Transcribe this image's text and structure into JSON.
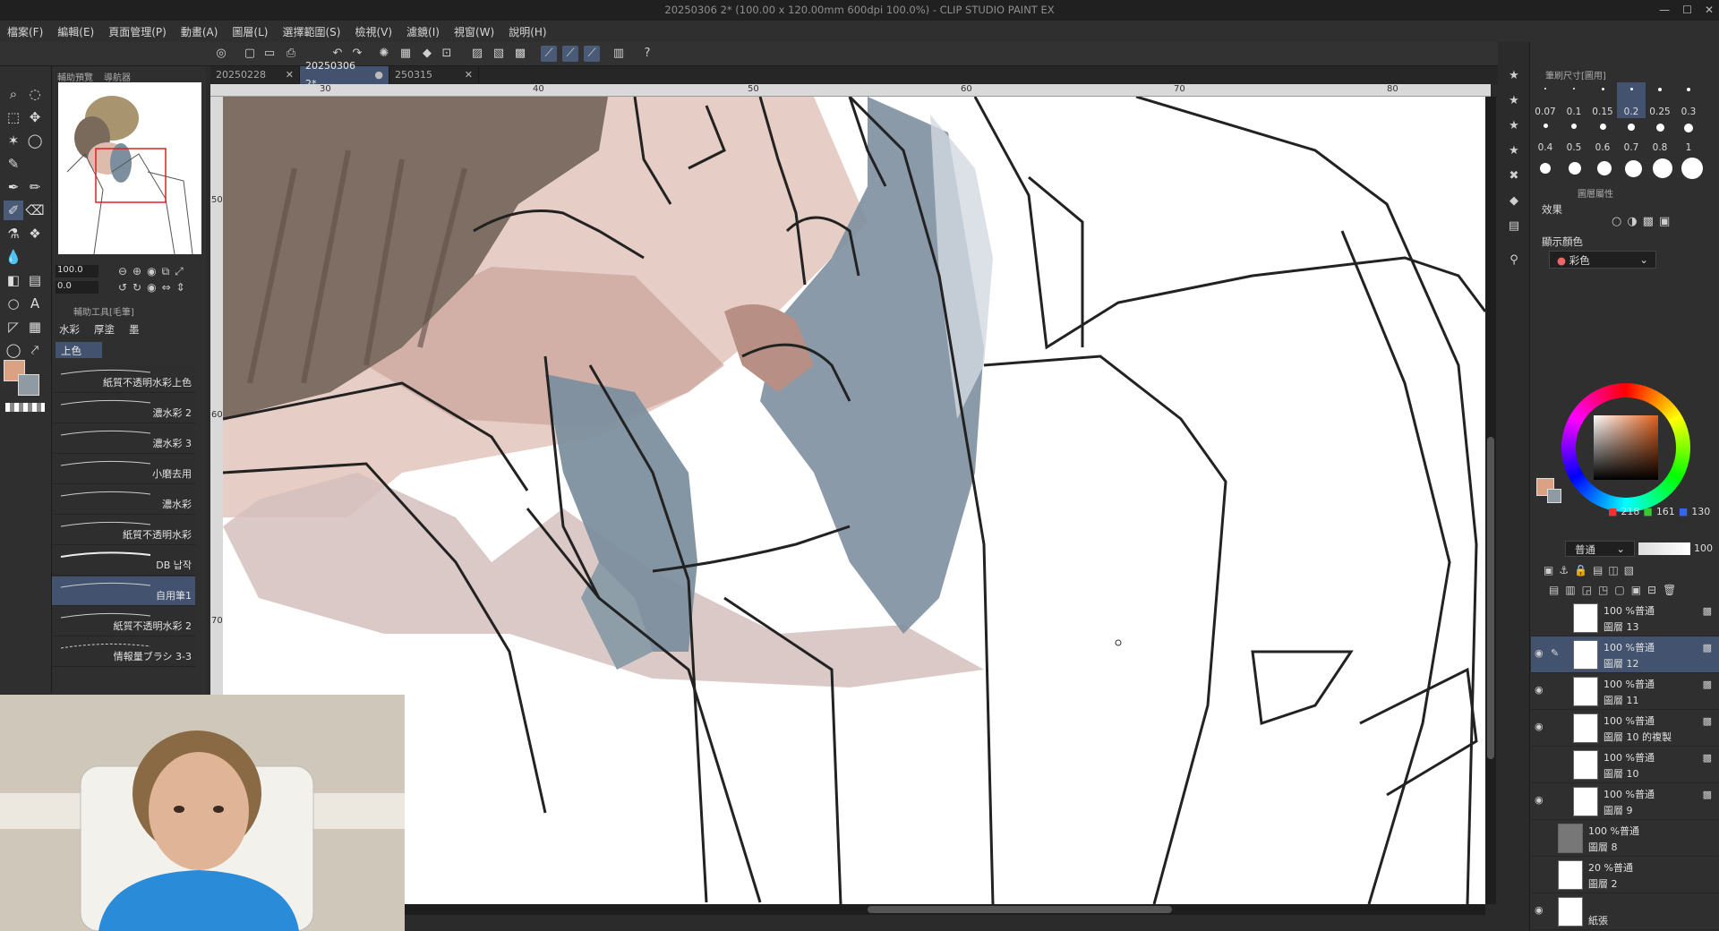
{
  "title": "20250306 2* (100.00 x 120.00mm 600dpi 100.0%) - CLIP STUDIO PAINT EX",
  "menu": [
    "檔案(F)",
    "編輯(E)",
    "頁面管理(P)",
    "動畫(A)",
    "圖層(L)",
    "選擇範圍(S)",
    "檢視(V)",
    "濾鏡(I)",
    "視窗(W)",
    "說明(H)"
  ],
  "tabs": [
    {
      "label": "20250228"
    },
    {
      "label": "20250306 2*"
    },
    {
      "label": "250315"
    }
  ],
  "ruler": {
    "h": [
      "30",
      "40",
      "50",
      "60",
      "70",
      "80"
    ],
    "v": [
      "50",
      "60",
      "70"
    ]
  },
  "navigator": {
    "tab1": "輔助預覽",
    "tab2": "導航器",
    "zoom": "100.0",
    "rotate": "0.0"
  },
  "subtool": {
    "header": "輔助工具[毛筆]",
    "groups": [
      "水彩",
      "厚塗",
      "墨"
    ],
    "active_group": "上色",
    "brushes": [
      "紙質不透明水彩上色",
      "濃水彩 2",
      "濃水彩 3",
      "小磨去用",
      "濃水彩",
      "紙質不透明水彩",
      "DB 납작",
      "自用筆1",
      "紙質不透明水彩 2",
      "情報量ブラシ 3-3"
    ],
    "active_brush": "自用筆1"
  },
  "brush_size": {
    "header": "筆刷尺寸[圖用]",
    "values": [
      "0.07",
      "0.1",
      "0.15",
      "0.2",
      "0.25",
      "0.3",
      "0.4",
      "0.5",
      "0.6",
      "0.7",
      "0.8",
      "1"
    ],
    "active": "0.2"
  },
  "layer_prop": {
    "header": "圖層屬性",
    "effect_label": "效果",
    "display_color_label": "顯示顏色",
    "display_color_value": "彩色"
  },
  "color": {
    "r": "218",
    "g": "161",
    "b": "130",
    "main": "#DAA182",
    "sub": "#8f9aa3"
  },
  "layers_panel": {
    "blend": "普通",
    "opacity": "100"
  },
  "layers": [
    {
      "pct": "100 %普通",
      "name": "圖層 13",
      "eye": ""
    },
    {
      "pct": "100 %普通",
      "name": "圖層 12",
      "eye": "◉",
      "active": true
    },
    {
      "pct": "100 %普通",
      "name": "圖層 11",
      "eye": "◉"
    },
    {
      "pct": "100 %普通",
      "name": "圖層 10 的複製",
      "eye": "◉"
    },
    {
      "pct": "100 %普通",
      "name": "圖層 10",
      "eye": ""
    },
    {
      "pct": "100 %普通",
      "name": "圖層 9",
      "eye": "◉"
    },
    {
      "pct": "100 %普通",
      "name": "圖層 8",
      "eye": ""
    },
    {
      "pct": "20 %普通",
      "name": "圖層 2",
      "eye": ""
    },
    {
      "pct": "",
      "name": "紙張",
      "eye": "◉"
    }
  ]
}
